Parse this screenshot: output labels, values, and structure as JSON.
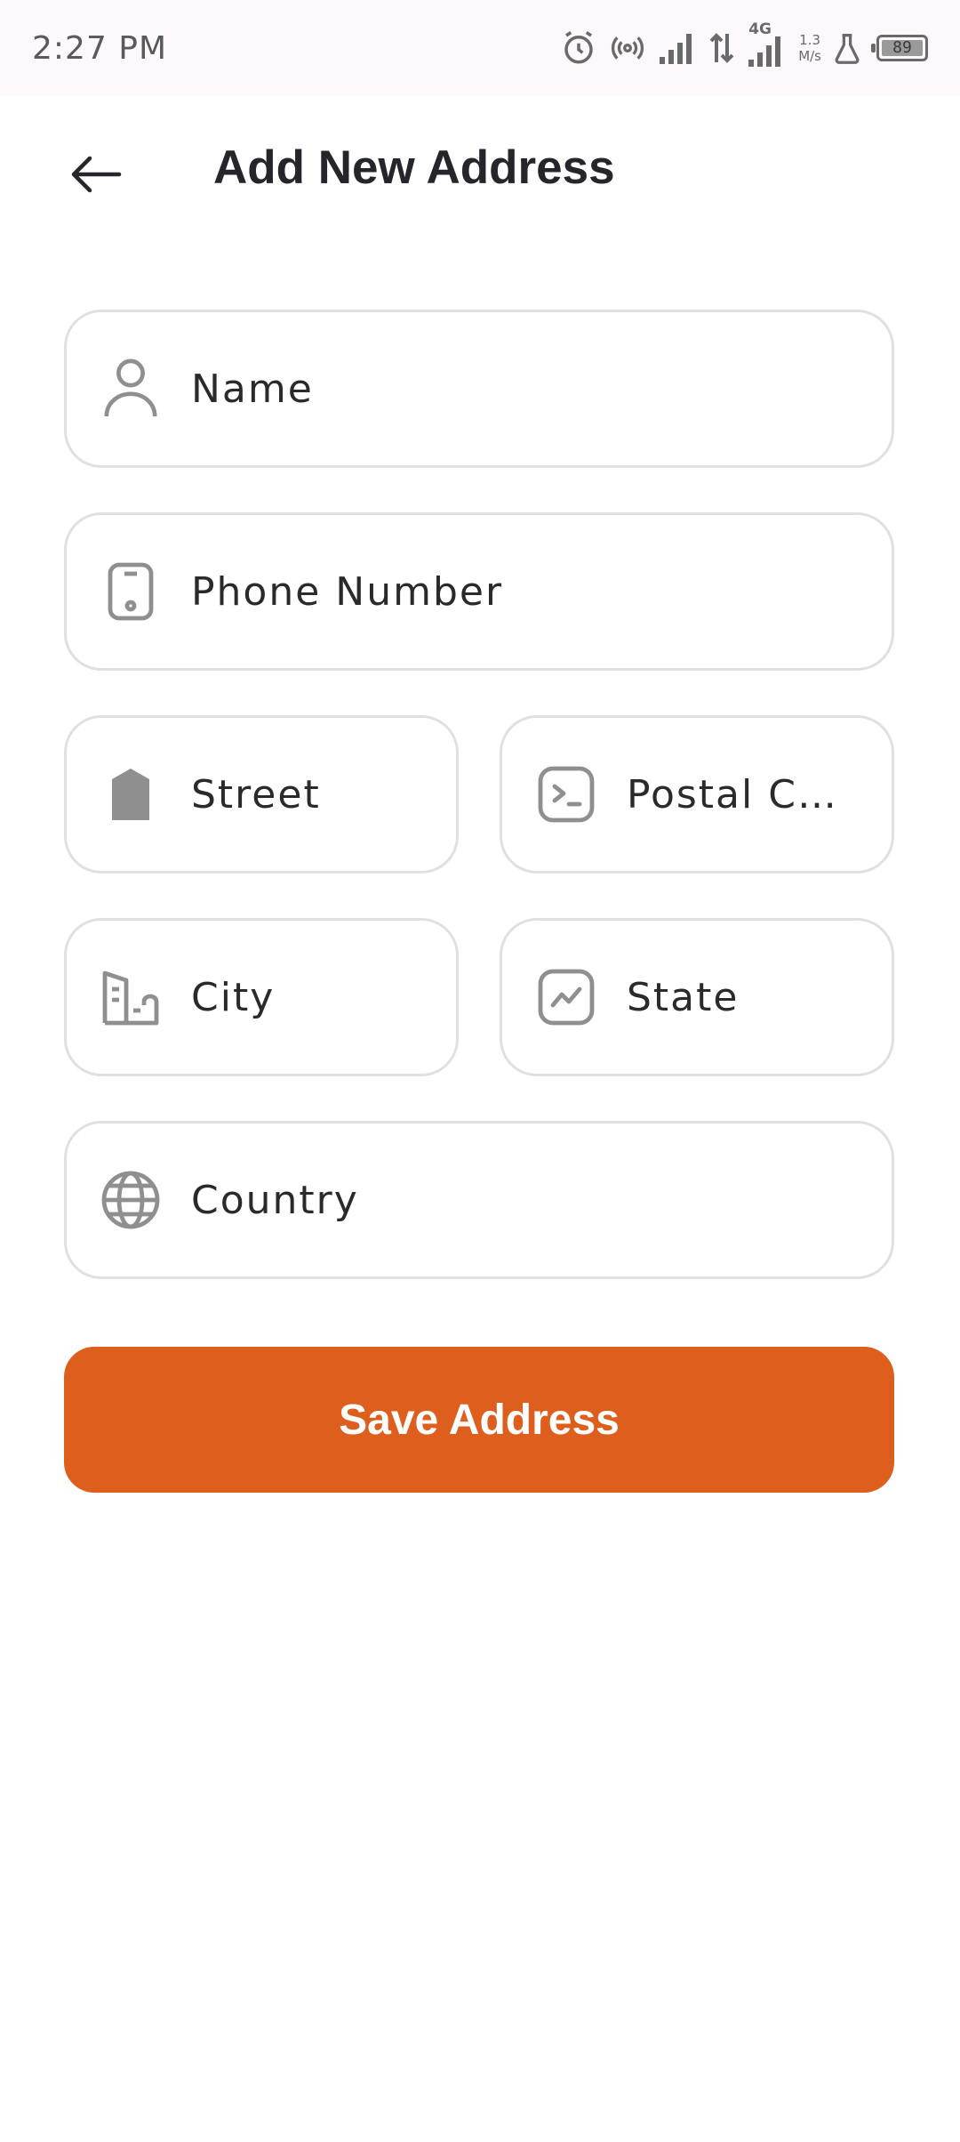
{
  "status_bar": {
    "time": "2:27 PM",
    "network_type": "4G",
    "speed_value": "1.3",
    "speed_unit": "M/s",
    "battery": "89"
  },
  "header": {
    "title": "Add New Address"
  },
  "form": {
    "name": {
      "placeholder": "Name",
      "value": ""
    },
    "phone": {
      "placeholder": "Phone Number",
      "value": ""
    },
    "street": {
      "placeholder": "Street",
      "value": ""
    },
    "postal_code": {
      "placeholder": "Postal C…",
      "value": ""
    },
    "city": {
      "placeholder": "City",
      "value": ""
    },
    "state": {
      "placeholder": "State",
      "value": ""
    },
    "country": {
      "placeholder": "Country",
      "value": ""
    }
  },
  "actions": {
    "save_label": "Save Address"
  },
  "colors": {
    "accent": "#de5e1e",
    "field_border": "#e0e0e0",
    "icon": "#8f8f8f",
    "title": "#25262b"
  },
  "icons": {
    "back": "arrow-left-icon",
    "name": "person-icon",
    "phone": "mobile-phone-icon",
    "street": "street-tag-icon",
    "postal_code": "terminal-box-icon",
    "city": "buildings-icon",
    "state": "chart-box-icon",
    "country": "globe-icon"
  }
}
